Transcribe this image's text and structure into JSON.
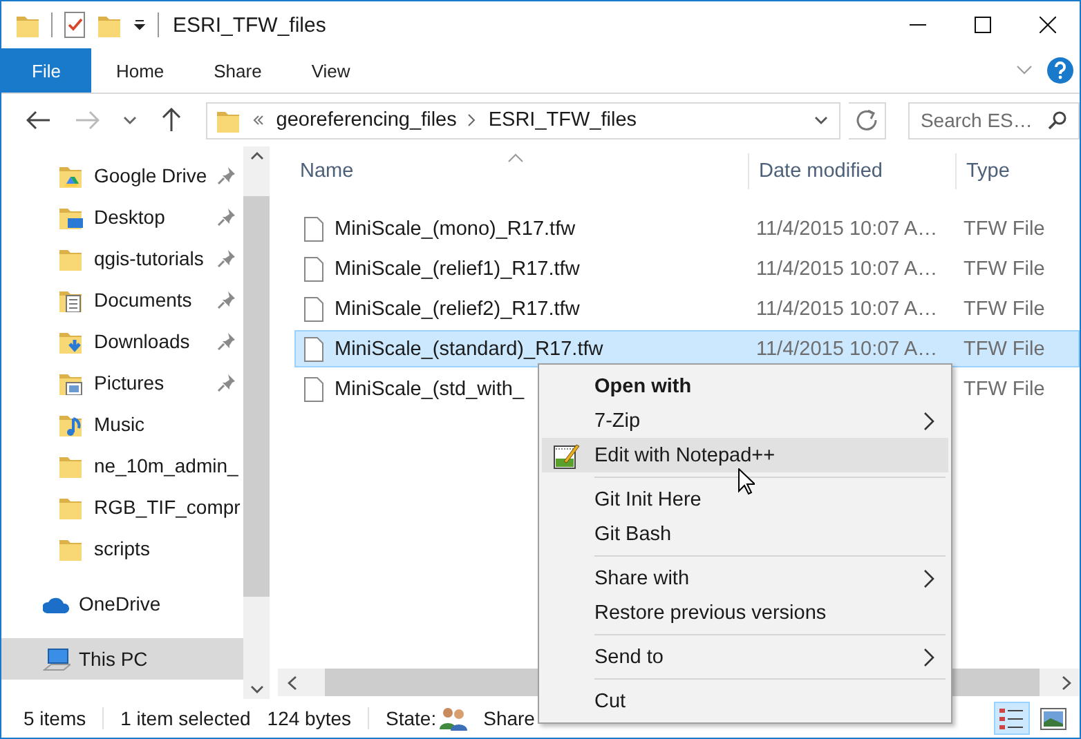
{
  "window": {
    "title": "ESRI_TFW_files"
  },
  "ribbon": {
    "tabs": [
      {
        "label": "File",
        "selected": true
      },
      {
        "label": "Home",
        "selected": false
      },
      {
        "label": "Share",
        "selected": false
      },
      {
        "label": "View",
        "selected": false
      }
    ]
  },
  "address": {
    "path": [
      "georeferencing_files",
      "ESRI_TFW_files"
    ],
    "search_placeholder": "Search ES…"
  },
  "sidebar": {
    "items": [
      {
        "label": "Google Drive",
        "kind": "drive",
        "pinned": true,
        "selected": false
      },
      {
        "label": "Desktop",
        "kind": "desktop",
        "pinned": true,
        "selected": false
      },
      {
        "label": "qgis-tutorials",
        "kind": "folder",
        "pinned": true,
        "selected": false
      },
      {
        "label": "Documents",
        "kind": "documents",
        "pinned": true,
        "selected": false
      },
      {
        "label": "Downloads",
        "kind": "downloads",
        "pinned": true,
        "selected": false
      },
      {
        "label": "Pictures",
        "kind": "pictures",
        "pinned": true,
        "selected": false
      },
      {
        "label": "Music",
        "kind": "music",
        "pinned": false,
        "selected": false
      },
      {
        "label": "ne_10m_admin_",
        "kind": "folder",
        "pinned": false,
        "selected": false
      },
      {
        "label": "RGB_TIF_compr",
        "kind": "folder",
        "pinned": false,
        "selected": false
      },
      {
        "label": "scripts",
        "kind": "folder",
        "pinned": false,
        "selected": false
      },
      {
        "label": "OneDrive",
        "kind": "cloud",
        "pinned": false,
        "selected": false
      },
      {
        "label": "This PC",
        "kind": "computer",
        "pinned": false,
        "selected": true
      }
    ]
  },
  "table": {
    "columns": [
      "Name",
      "Date modified",
      "Type"
    ],
    "rows": [
      {
        "name": "MiniScale_(mono)_R17.tfw",
        "date": "11/4/2015 10:07 A…",
        "type": "TFW File",
        "selected": false
      },
      {
        "name": "MiniScale_(relief1)_R17.tfw",
        "date": "11/4/2015 10:07 A…",
        "type": "TFW File",
        "selected": false
      },
      {
        "name": "MiniScale_(relief2)_R17.tfw",
        "date": "11/4/2015 10:07 A…",
        "type": "TFW File",
        "selected": false
      },
      {
        "name": "MiniScale_(standard)_R17.tfw",
        "date": "11/4/2015 10:07 A…",
        "type": "TFW File",
        "selected": true
      },
      {
        "name": "MiniScale_(std_with_",
        "type": "TFW File",
        "selected": false
      }
    ]
  },
  "context_menu": {
    "items": [
      {
        "kind": "header",
        "label": "Open with"
      },
      {
        "kind": "item",
        "label": "7-Zip",
        "submenu": true,
        "highlighted": false
      },
      {
        "kind": "app_item",
        "label": "Edit with Notepad++",
        "submenu": false,
        "highlighted": true
      },
      {
        "kind": "separator"
      },
      {
        "kind": "item",
        "label": "Git Init Here",
        "submenu": false,
        "highlighted": false
      },
      {
        "kind": "item",
        "label": "Git Bash",
        "submenu": false,
        "highlighted": false
      },
      {
        "kind": "separator"
      },
      {
        "kind": "item",
        "label": "Share with",
        "submenu": true,
        "highlighted": false
      },
      {
        "kind": "item",
        "label": "Restore previous versions",
        "submenu": false,
        "highlighted": false
      },
      {
        "kind": "separator"
      },
      {
        "kind": "item",
        "label": "Send to",
        "submenu": true,
        "highlighted": false
      },
      {
        "kind": "separator"
      },
      {
        "kind": "item",
        "label": "Cut",
        "submenu": false,
        "highlighted": false
      }
    ]
  },
  "status_bar": {
    "items_count": "5 items",
    "selection": "1 item selected",
    "size": "124 bytes",
    "state_label": "State:",
    "state_value": "Share",
    "views": [
      {
        "kind": "details",
        "selected": true
      },
      {
        "kind": "large_icons",
        "selected": false
      }
    ]
  }
}
